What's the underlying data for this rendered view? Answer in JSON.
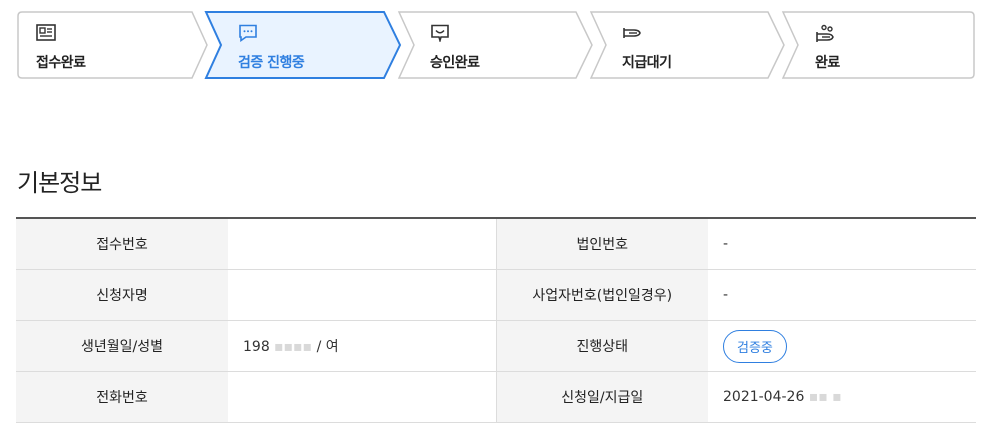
{
  "progress": {
    "steps": [
      {
        "label": "접수완료",
        "icon": "id-card-icon",
        "active": false
      },
      {
        "label": "검증 진행중",
        "icon": "chat-dots-icon",
        "active": true
      },
      {
        "label": "승인완료",
        "icon": "approve-icon",
        "active": false
      },
      {
        "label": "지급대기",
        "icon": "hand-pay-icon",
        "active": false
      },
      {
        "label": "완료",
        "icon": "hand-coins-icon",
        "active": false
      }
    ],
    "active_color": "#2f7fe0"
  },
  "section": {
    "title": "기본정보"
  },
  "info": {
    "receipt_no_label": "접수번호",
    "receipt_no_value": "",
    "corp_no_label": "법인번호",
    "corp_no_value": "-",
    "applicant_label": "신청자명",
    "applicant_value": "",
    "biz_no_label": "사업자번호(법인일경우)",
    "biz_no_value": "-",
    "birth_gender_label": "생년월일/성별",
    "birth_gender_value": "198",
    "gender_value": "/ 여",
    "status_label": "진행상태",
    "status_value": "검증중",
    "phone_label": "전화번호",
    "phone_value": "",
    "date_label": "신청일/지급일",
    "date_value": "2021-04-26"
  }
}
